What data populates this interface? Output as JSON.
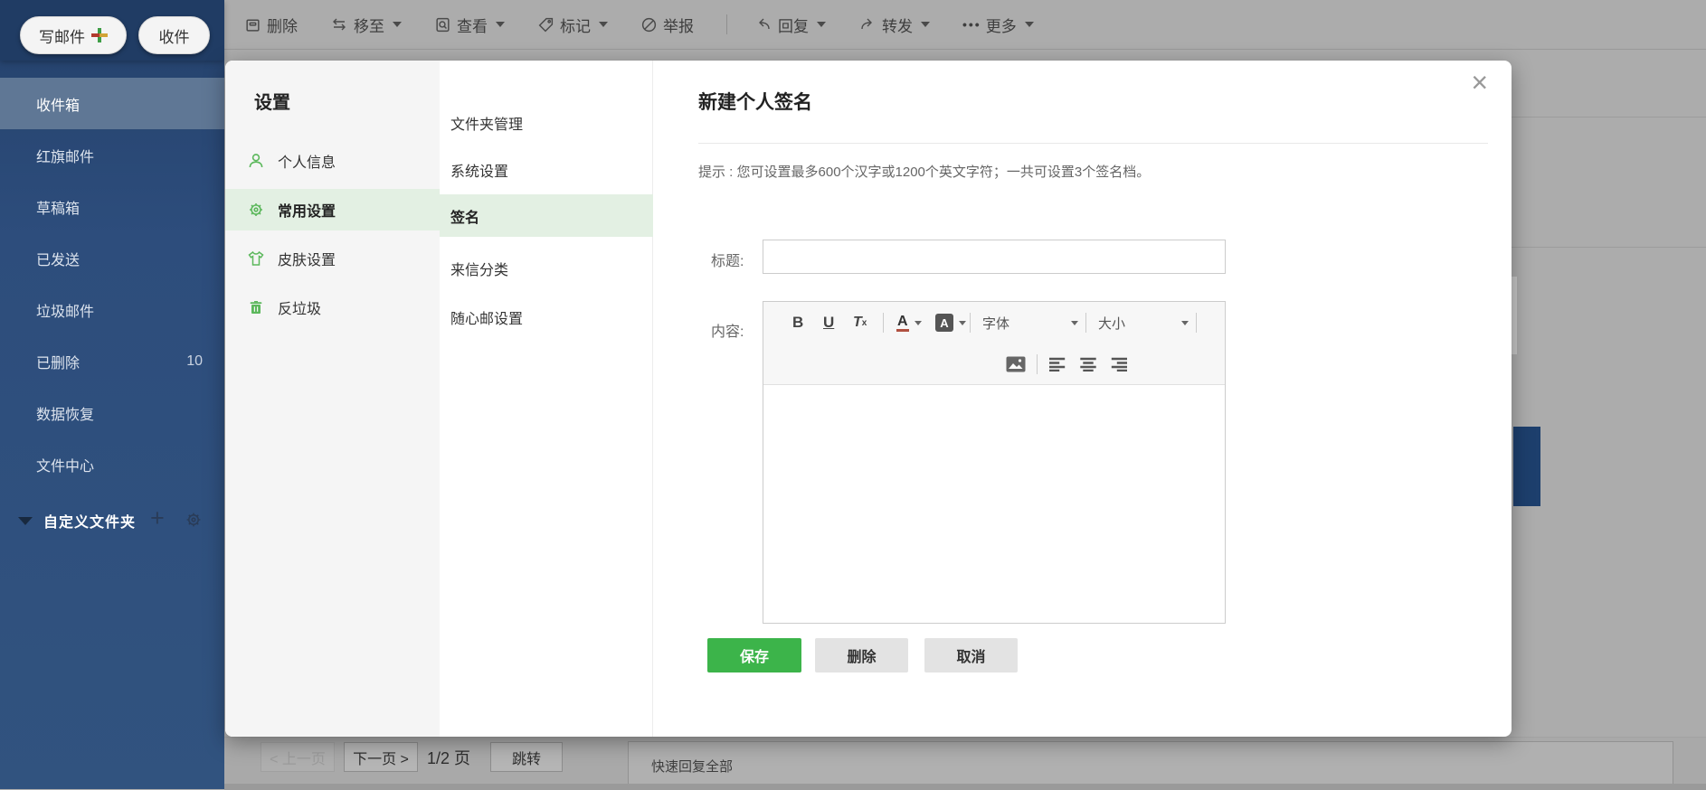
{
  "colors": {
    "sidebar_navy": "#2d4d7c",
    "sidebar_selected": "#5f7795",
    "accent_green": "#3cb44a",
    "icon_green": "#5cb85c",
    "highlight_green": "#e3f0e3",
    "dim_background": "#acacac",
    "right_blue_block": "#1d3f6d"
  },
  "sidebar": {
    "compose_label": "写邮件",
    "receive_label": "收件",
    "items": [
      {
        "label": "收件箱",
        "selected": true
      },
      {
        "label": "红旗邮件"
      },
      {
        "label": "草稿箱"
      },
      {
        "label": "已发送"
      },
      {
        "label": "垃圾邮件"
      },
      {
        "label": "已删除",
        "count": "10"
      },
      {
        "label": "数据恢复"
      },
      {
        "label": "文件中心"
      }
    ],
    "custom_folder_label": "自定义文件夹"
  },
  "toolbar": {
    "items": [
      {
        "label": "删除",
        "icon": "trash-icon",
        "dropdown": false
      },
      {
        "label": "移至",
        "icon": "move-icon",
        "dropdown": true
      },
      {
        "label": "查看",
        "icon": "view-icon",
        "dropdown": true
      },
      {
        "label": "标记",
        "icon": "tag-icon",
        "dropdown": true
      },
      {
        "label": "举报",
        "icon": "report-icon",
        "dropdown": false
      },
      {
        "label": "回复",
        "icon": "reply-icon",
        "dropdown": true
      },
      {
        "label": "转发",
        "icon": "forward-icon",
        "dropdown": true
      },
      {
        "label": "更多",
        "icon": "more-dots-icon",
        "dropdown": true
      }
    ]
  },
  "settings": {
    "title": "设置",
    "nav": [
      {
        "label": "个人信息",
        "icon": "user-icon",
        "selected": false
      },
      {
        "label": "常用设置",
        "icon": "gear-icon",
        "selected": true
      },
      {
        "label": "皮肤设置",
        "icon": "tshirt-icon",
        "selected": false
      },
      {
        "label": "反垃圾",
        "icon": "trash-icon",
        "selected": false
      }
    ],
    "subnav": [
      {
        "label": "文件夹管理",
        "selected": false
      },
      {
        "label": "系统设置",
        "selected": false
      },
      {
        "label": "签名",
        "selected": true
      },
      {
        "label": "来信分类",
        "selected": false
      },
      {
        "label": "随心邮设置",
        "selected": false
      }
    ]
  },
  "signature_panel": {
    "title": "新建个人签名",
    "hint": "提示 : 您可设置最多600个汉字或1200个英文字符；一共可设置3个签名档。",
    "title_label": "标题:",
    "content_label": "内容:",
    "title_value": "",
    "close_glyph": "×",
    "editor": {
      "bold": "B",
      "underline": "U",
      "clear_format": "T",
      "clear_format_sub": "x",
      "color_a": "A",
      "bg_a": "A",
      "font_label": "字体",
      "size_label": "大小"
    },
    "buttons": {
      "save": "保存",
      "delete": "删除",
      "cancel": "取消"
    }
  },
  "pagination": {
    "prev": "< 上一页",
    "next": "下一页 >",
    "page_indicator": "1/2 页",
    "jump": "跳转"
  },
  "quick_reply_label": "快速回复全部"
}
